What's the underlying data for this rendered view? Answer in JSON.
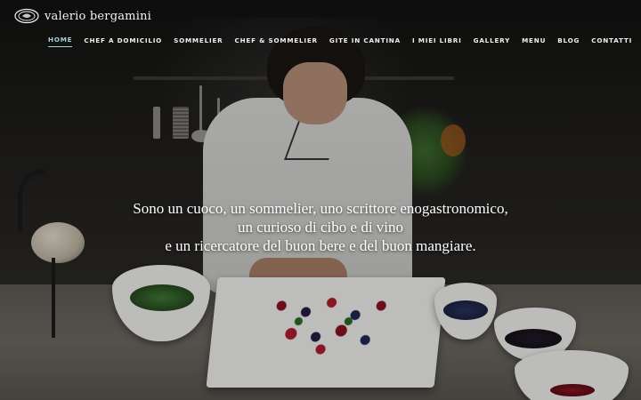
{
  "brand": {
    "name": "valerio bergamini",
    "logo_icon": "plate-logo-icon"
  },
  "nav": {
    "items": [
      {
        "label": "HOME",
        "active": true
      },
      {
        "label": "CHEF A DOMICILIO",
        "active": false
      },
      {
        "label": "SOMMELIER",
        "active": false
      },
      {
        "label": "CHEF & SOMMELIER",
        "active": false
      },
      {
        "label": "GITE IN CANTINA",
        "active": false
      },
      {
        "label": "I MIEI LIBRI",
        "active": false
      },
      {
        "label": "GALLERY",
        "active": false
      },
      {
        "label": "MENU",
        "active": false
      },
      {
        "label": "BLOG",
        "active": false
      },
      {
        "label": "CONTATTI",
        "active": false
      }
    ],
    "languages": [
      {
        "icon": "italian-flag-icon"
      },
      {
        "icon": "english-flag-icon"
      }
    ],
    "active_color": "#9fd3df"
  },
  "hero": {
    "line1": "Sono un cuoco, un sommelier, uno scrittore enogastronomico,",
    "line2": "un curioso di cibo e di vino",
    "line3": "e un ricercatore del buon bere e del buon mangiare."
  }
}
